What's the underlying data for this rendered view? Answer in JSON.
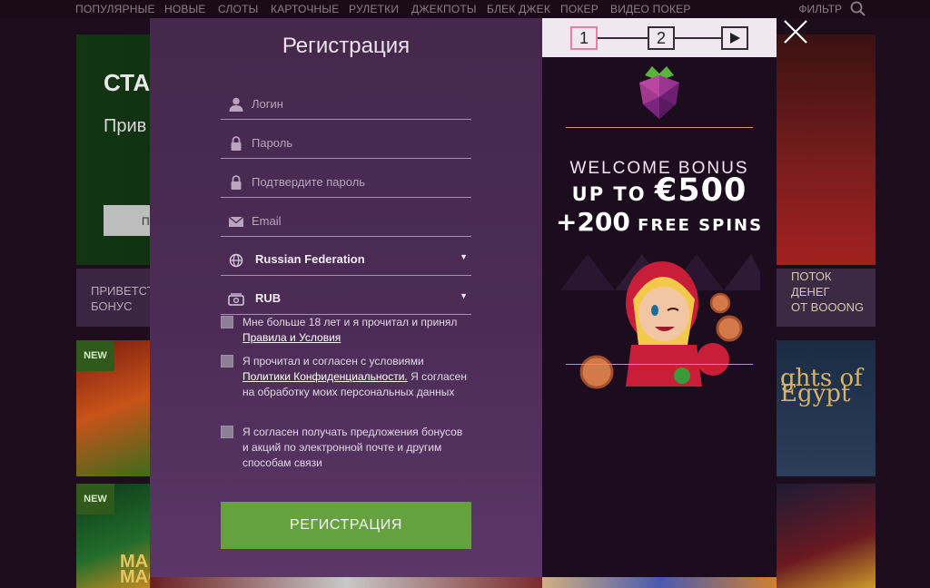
{
  "nav": {
    "items": [
      "ПОПУЛЯРНЫЕ",
      "НОВЫЕ",
      "СЛОТЫ",
      "КАРТОЧНЫЕ",
      "РУЛЕТКИ",
      "ДЖЕКПОТЫ",
      "БЛЕК ДЖЕК",
      "ПОКЕР",
      "ВИДЕО ПОКЕР"
    ],
    "filter": "ФИЛЬТР"
  },
  "background": {
    "promo_heading": "СТА",
    "promo_sub": "Прив",
    "promo_button": "П",
    "tile_bonus": "ПРИВЕТСТ\nБОНУС",
    "new_badge": "NEW",
    "tile_egypt": "ghts of Egypt",
    "tile_magic": "MA\nMAGIC",
    "tile_potok": "ПОТОК\nДЕНЕГ\nОТ BOOONG"
  },
  "form": {
    "title": "Регистрация",
    "login_placeholder": "Логин",
    "password_placeholder": "Пароль",
    "confirm_placeholder": "Подтвердите пароль",
    "email_placeholder": "Email",
    "country_value": "Russian Federation",
    "currency_value": "RUB",
    "check_age_text": "Мне больше 18 лет и я прочитал и принял",
    "check_age_link": "Правила и Условия",
    "check_privacy_text": "Я прочитал и согласен с условиями",
    "check_privacy_link": "Политики Конфиденциальности.",
    "check_privacy_rest": "Я согласен на обработку моих персональных данных",
    "check_offers_text": "Я согласен получать предложения бонусов и акций по электронной почте и другим способам связи",
    "submit_label": "РЕГИСТРАЦИЯ"
  },
  "promo": {
    "steps": [
      "1",
      "2"
    ],
    "welcome": "WELCOME BONUS",
    "up_to": "UP TO ",
    "amount": "€500",
    "spins_count": "+200",
    "spins_label": " FREE SPINS"
  },
  "colors": {
    "submit": "#66a13f",
    "active_step": "#e67fa0",
    "form_bg": "#4c2c56"
  },
  "icons": [
    "search-icon",
    "close-icon",
    "user-icon",
    "lock-icon",
    "mail-icon",
    "globe-icon",
    "currency-icon",
    "play-icon",
    "raspberry-logo"
  ]
}
